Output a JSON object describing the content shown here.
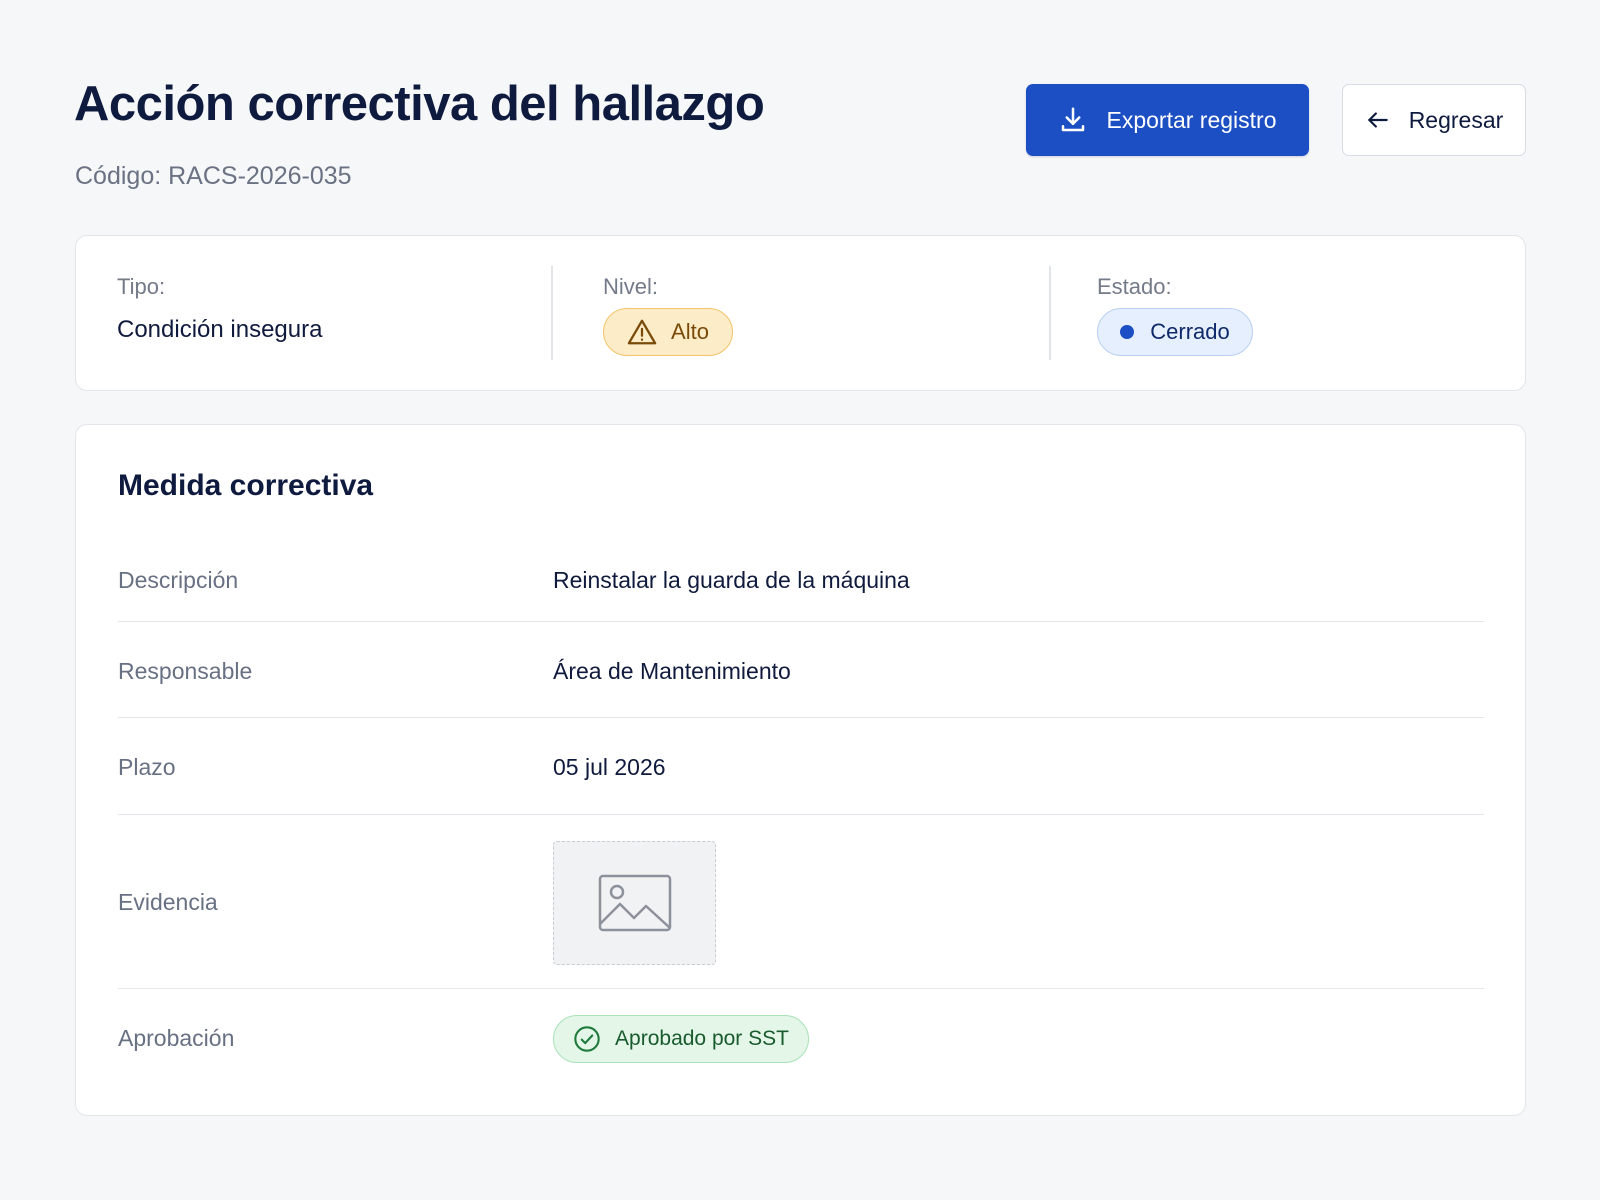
{
  "header": {
    "title": "Acción correctiva del hallazgo",
    "code": "Código: RACS-2026-035",
    "export_label": "Exportar registro",
    "back_label": "Regresar"
  },
  "summary": {
    "type_label": "Tipo:",
    "type_value": "Condición insegura",
    "level_label": "Nivel:",
    "level_value": "Alto",
    "state_label": "Estado:",
    "state_value": "Cerrado"
  },
  "details": {
    "title": "Medida correctiva",
    "rows": [
      {
        "label": "Descripción",
        "value": "Reinstalar la guarda de la máquina"
      },
      {
        "label": "Responsable",
        "value": "Área de Mantenimiento"
      },
      {
        "label": "Plazo",
        "value": "05 jul 2026"
      },
      {
        "label": "Evidencia",
        "value": ""
      },
      {
        "label": "Aprobación",
        "value": "Aprobado por SST"
      }
    ]
  },
  "icons": {
    "export": "download-icon",
    "back": "arrow-left-icon",
    "level": "warning-triangle-icon",
    "state": "dot-icon",
    "evidence": "image-placeholder-icon",
    "approved": "check-circle-icon"
  },
  "colors": {
    "primary": "#1c4fc4",
    "warning_bg": "#fdecc8",
    "warning_text": "#7a4a08",
    "info_bg": "#e6effd",
    "success_bg": "#e3f6e8",
    "success_text": "#1a5b2e"
  }
}
